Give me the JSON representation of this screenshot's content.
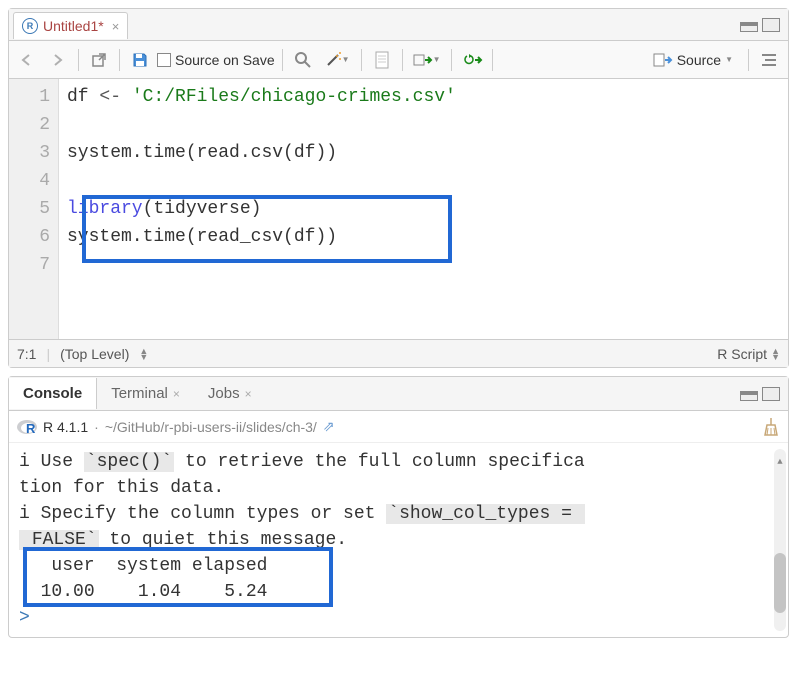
{
  "editor": {
    "tab_label": "Untitled1*",
    "source_on_save_label": "Source on Save",
    "source_button_label": "Source",
    "gutter": [
      "1",
      "2",
      "3",
      "4",
      "5",
      "6",
      "7"
    ],
    "code_lines": [
      {
        "tokens": [
          {
            "t": "df ",
            "c": "tok-sym"
          },
          {
            "t": "<- ",
            "c": "tok-op"
          },
          {
            "t": "'C:/RFiles/chicago-crimes.csv'",
            "c": "tok-str"
          }
        ]
      },
      {
        "tokens": []
      },
      {
        "tokens": [
          {
            "t": "system.time",
            "c": "tok-call"
          },
          {
            "t": "(read.csv(df))",
            "c": "tok-sym"
          }
        ]
      },
      {
        "tokens": []
      },
      {
        "tokens": [
          {
            "t": "library",
            "c": "tok-fn"
          },
          {
            "t": "(tidyverse)",
            "c": "tok-sym"
          }
        ]
      },
      {
        "tokens": [
          {
            "t": "system.time",
            "c": "tok-call"
          },
          {
            "t": "(read_csv(df))",
            "c": "tok-sym"
          }
        ]
      },
      {
        "tokens": []
      }
    ],
    "cursor_pos": "7:1",
    "scope": "(Top Level)",
    "file_type": "R Script"
  },
  "console": {
    "tabs": {
      "console": "Console",
      "terminal": "Terminal",
      "jobs": "Jobs"
    },
    "version": "R 4.1.1",
    "path_sep": "·",
    "path": "~/GitHub/r-pbi-users-ii/slides/ch-3/",
    "output": [
      {
        "segs": [
          {
            "t": "i Use "
          },
          {
            "t": "`spec()`",
            "bg": true
          },
          {
            "t": " to retrieve the full column specifica"
          }
        ]
      },
      {
        "segs": [
          {
            "t": "tion for this data."
          }
        ]
      },
      {
        "segs": [
          {
            "t": "i Specify the column types or set "
          },
          {
            "t": "`show_col_types = ",
            "bg": true
          }
        ]
      },
      {
        "segs": [
          {
            "t": " FALSE`",
            "bg": true
          },
          {
            "t": " to quiet this message."
          }
        ]
      },
      {
        "segs": [
          {
            "t": "   user  system elapsed "
          }
        ]
      },
      {
        "segs": [
          {
            "t": "  10.00    1.04    5.24 "
          }
        ]
      },
      {
        "segs": [
          {
            "t": "> ",
            "prompt": true
          }
        ]
      }
    ]
  },
  "chart_data": {
    "type": "table",
    "title": "system.time output",
    "columns": [
      "user",
      "system",
      "elapsed"
    ],
    "values": [
      10.0,
      1.04,
      5.24
    ]
  }
}
